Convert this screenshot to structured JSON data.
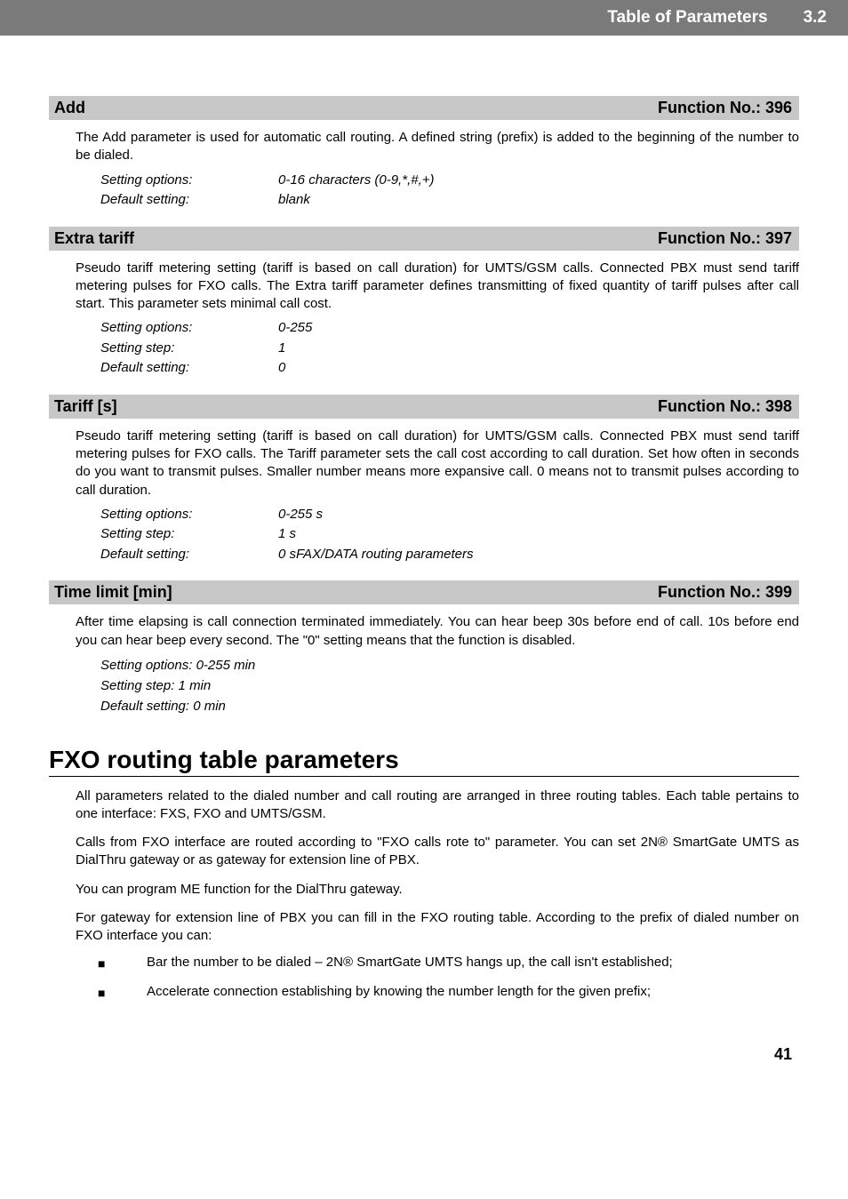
{
  "banner": {
    "title": "Table of Parameters",
    "section": "3.2"
  },
  "items": [
    {
      "header_left": "Add",
      "header_right": "Function No.: 396",
      "paras": [
        "The Add parameter is used for automatic call routing. A defined string (prefix) is added to the beginning of the number to be dialed."
      ],
      "kv": [
        {
          "k": "Setting options:",
          "v": "0-16 characters (0-9,*,#,+)"
        },
        {
          "k": "Default setting:",
          "v": "blank"
        }
      ]
    },
    {
      "header_left": "Extra tariff",
      "header_right": "Function No.: 397",
      "paras": [
        "Pseudo tariff metering setting (tariff is based on call duration) for UMTS/GSM calls. Connected PBX must send tariff metering pulses for FXO calls. The Extra tariff parameter defines transmitting of fixed quantity of tariff pulses after call start. This parameter sets minimal call cost."
      ],
      "kv": [
        {
          "k": "Setting options:",
          "v": "0-255"
        },
        {
          "k": "Setting step:",
          "v": "1"
        },
        {
          "k": "Default setting:",
          "v": "0"
        }
      ]
    },
    {
      "header_left": "Tariff [s]",
      "header_right": "Function No.: 398",
      "paras": [
        "Pseudo tariff metering setting (tariff is based on call duration) for UMTS/GSM calls. Connected PBX must send tariff metering pulses for FXO calls. The Tariff parameter sets the call cost according to call duration. Set how often in seconds do you want to transmit pulses. Smaller number means more expansive call. 0 means not to transmit pulses according to call duration."
      ],
      "kv": [
        {
          "k": "Setting options:",
          "v": "0-255 s"
        },
        {
          "k": "Setting step:",
          "v": "1 s"
        },
        {
          "k": "Default setting:",
          "v": "0 sFAX/DATA routing parameters"
        }
      ]
    },
    {
      "header_left": "Time limit [min]",
      "header_right": "Function No.: 399",
      "paras": [
        "After time elapsing is call connection terminated immediately. You can hear beep 30s before end of call. 10s before end you can hear beep every second. The \"0\" setting means that the function is disabled."
      ],
      "singles": [
        "Setting options: 0-255 min",
        "Setting step: 1 min",
        "Default setting: 0 min"
      ]
    }
  ],
  "section_heading": "FXO routing table parameters",
  "section_body": [
    "All parameters related to the dialed number and call routing are arranged in three routing tables. Each table pertains to one interface: FXS, FXO and UMTS/GSM.",
    "Calls from FXO interface are routed according to \"FXO calls rote to\" parameter. You can set 2N® SmartGate UMTS as DialThru gateway or as gateway for extension line of PBX.",
    "You can program ME function for the DialThru gateway.",
    "For gateway  for extension line of PBX you can fill in the FXO routing table. According to the prefix of dialed number on FXO interface you can:"
  ],
  "bullets": [
    "Bar the number to be dialed – 2N® SmartGate UMTS hangs up, the call isn't established;",
    "Accelerate connection establishing by knowing the number length for the given prefix;"
  ],
  "page_number": "41"
}
